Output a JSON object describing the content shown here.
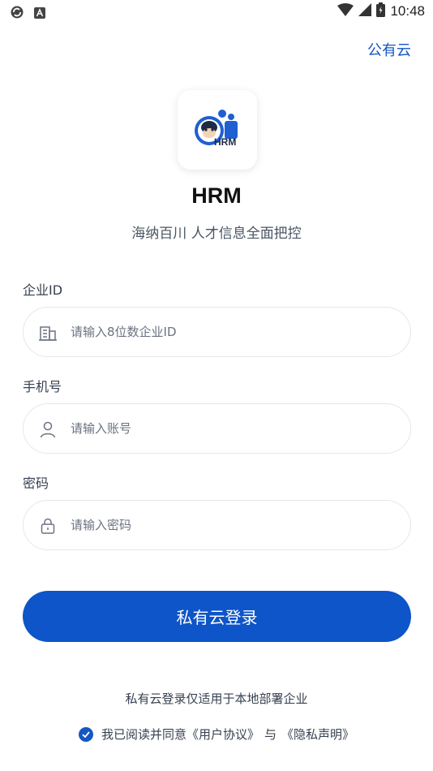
{
  "status_bar": {
    "time": "10:48",
    "icons": [
      "sync-icon",
      "a-icon",
      "wifi-icon",
      "signal-icon",
      "battery-icon"
    ]
  },
  "header": {
    "public_cloud_link": "公有云"
  },
  "brand": {
    "logo_text": "HRM",
    "app_name": "HRM",
    "slogan": "海纳百川 人才信息全面把控"
  },
  "form": {
    "company_id": {
      "label": "企业ID",
      "placeholder": "请输入8位数企业ID",
      "value": ""
    },
    "phone": {
      "label": "手机号",
      "placeholder": "请输入账号",
      "value": ""
    },
    "password": {
      "label": "密码",
      "placeholder": "请输入密码",
      "value": ""
    }
  },
  "login_button": "私有云登录",
  "note": "私有云登录仅适用于本地部署企业",
  "agreement": {
    "checked": true,
    "prefix": "我已阅读并同意",
    "user_agreement": "《用户协议》",
    "connector": "与",
    "privacy_statement": "《隐私声明》"
  },
  "colors": {
    "accent": "#0d55c8",
    "link": "#1557c0",
    "border": "#e5e7eb"
  }
}
